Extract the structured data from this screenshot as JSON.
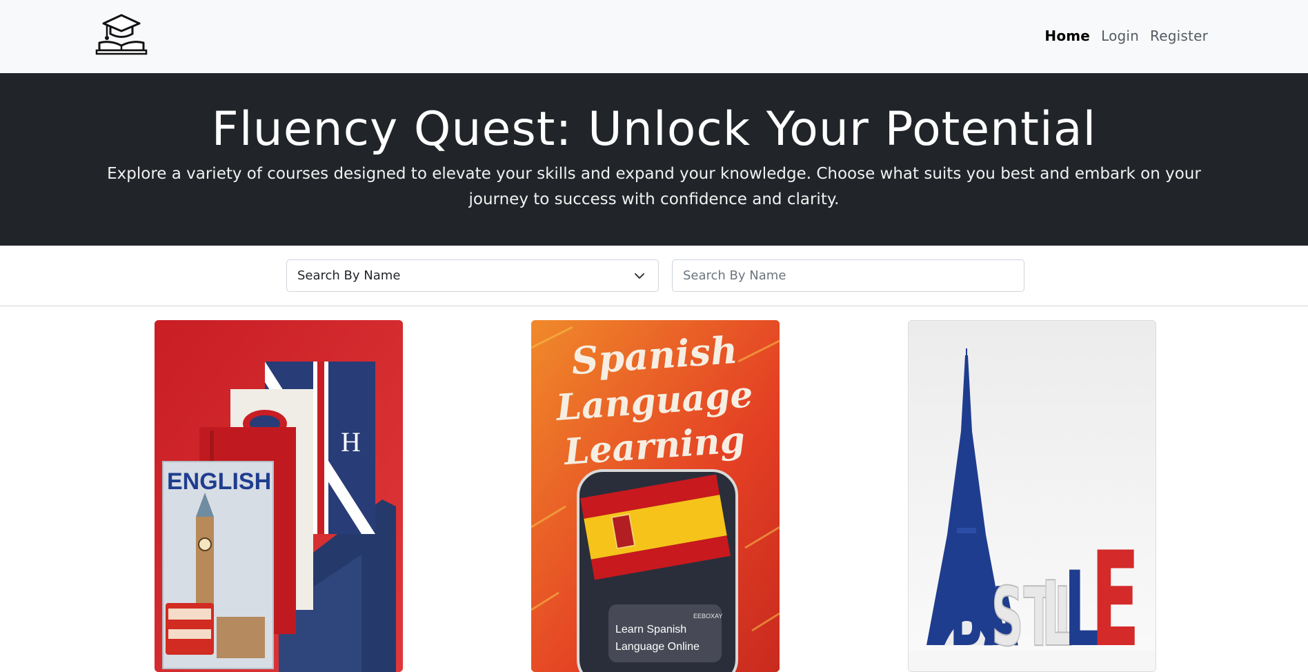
{
  "navbar": {
    "logo_icon": "graduation-cap-book-icon",
    "links": [
      {
        "label": "Home",
        "active": true
      },
      {
        "label": "Login",
        "active": false
      },
      {
        "label": "Register",
        "active": false
      }
    ]
  },
  "hero": {
    "title": "Fluency Quest: Unlock Your Potential",
    "subtitle": "Explore a variety of courses designed to elevate your skills and expand your knowledge. Choose what suits you best and embark on your journey to success with confidence and clarity."
  },
  "search": {
    "select_value": "Search By Name",
    "input_placeholder": "Search By Name"
  },
  "courses": [
    {
      "image_text": "ENGLISH",
      "spine_letter": "H"
    },
    {
      "image_text": "Spanish Language Learning",
      "overlay_brand": "EEBOXAY",
      "overlay_text": "Learn Spanish Language Online"
    },
    {
      "image_text": "BASTILLE"
    }
  ],
  "colors": {
    "navbar_bg": "#f8f9fa",
    "hero_bg": "#212529",
    "english_red": "#d42a2a",
    "spanish_orange": "#e6412a",
    "france_blue": "#1f3d8f"
  }
}
